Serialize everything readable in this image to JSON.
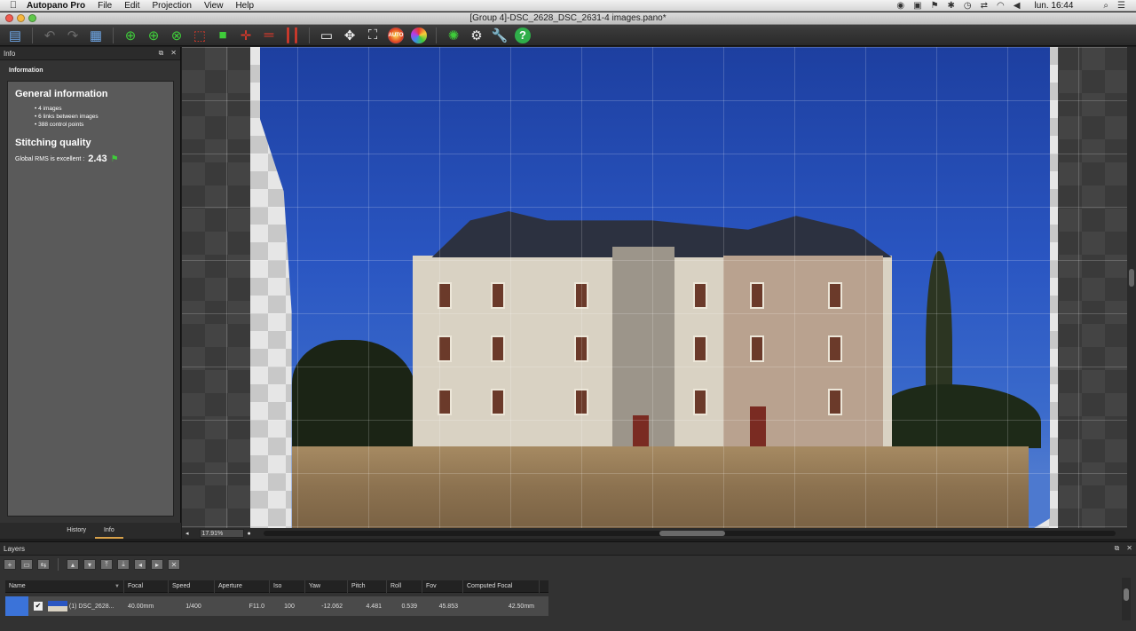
{
  "menubar": {
    "apple": "",
    "app": "Autopano Pro",
    "items": [
      "File",
      "Edit",
      "Projection",
      "View",
      "Help"
    ],
    "clock": "lun. 16:44"
  },
  "window": {
    "title": "[Group 4]-DSC_2628_DSC_2631-4 images.pano*"
  },
  "info_panel": {
    "header": "Info",
    "subheader": "Information",
    "general_title": "General information",
    "stats": [
      "4 images",
      "6 links between images",
      "388 control points"
    ],
    "quality_title": "Stitching quality",
    "rms_label": "Global RMS is excellent :",
    "rms_value": "2.43",
    "tabs": [
      "History",
      "Info"
    ],
    "active_tab": "Info"
  },
  "viewer": {
    "zoom": "17.91%"
  },
  "layers": {
    "header": "Layers",
    "columns": [
      "Name",
      "Focal",
      "Speed",
      "Aperture",
      "Iso",
      "Yaw",
      "Pitch",
      "Roll",
      "Fov",
      "Computed Focal"
    ],
    "rows": [
      {
        "checked": "✔",
        "name": "(1) DSC_2628...",
        "focal": "40.00mm",
        "speed": "1/400",
        "aperture": "F11.0",
        "iso": "100",
        "yaw": "-12.062",
        "pitch": "4.481",
        "roll": "0.539",
        "fov": "45.853",
        "computed_focal": "42.50mm"
      }
    ]
  },
  "colors": {
    "accent_selection": "#3b73d9",
    "tab_underline": "#d9a24a",
    "quality_flag": "#3fcc3a"
  }
}
